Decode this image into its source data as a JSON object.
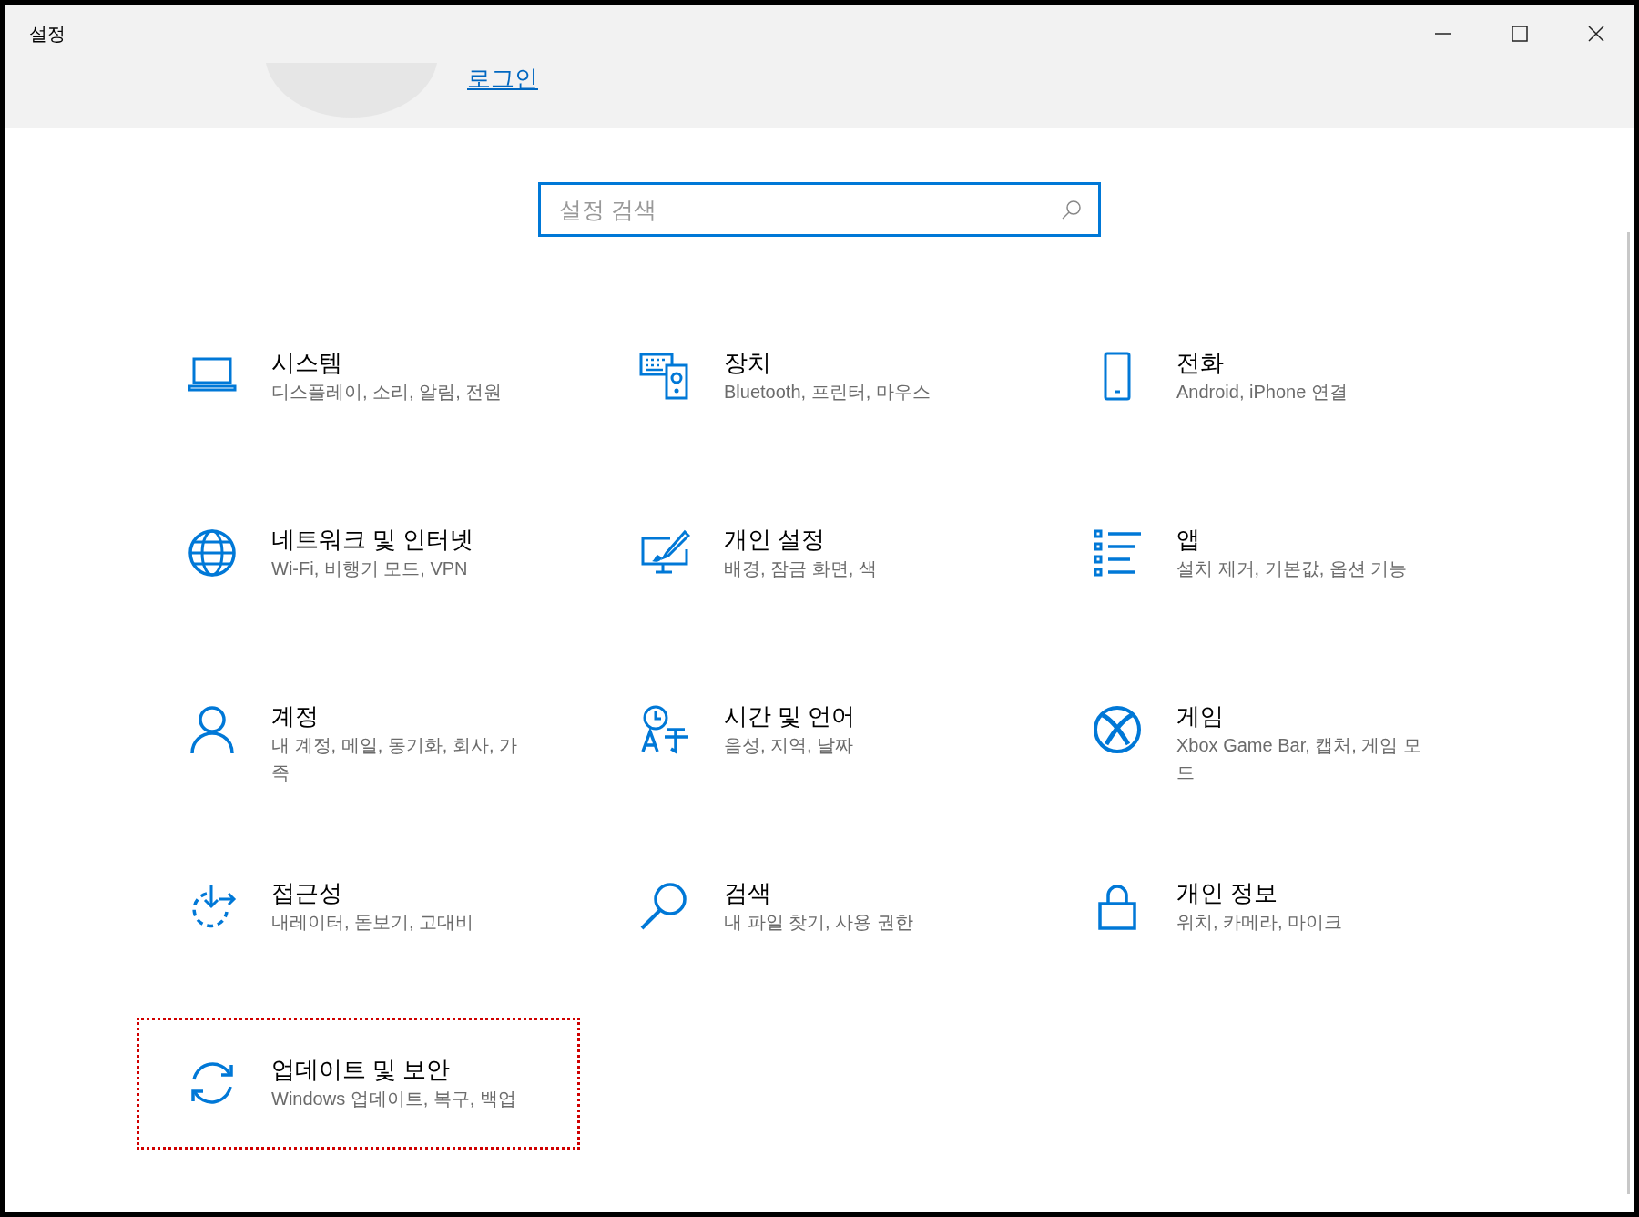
{
  "window": {
    "title": "설정"
  },
  "account": {
    "link": "로그인"
  },
  "search": {
    "placeholder": "설정 검색"
  },
  "tiles": [
    {
      "title": "시스템",
      "description": "디스플레이, 소리, 알림, 전원",
      "highlighted": false
    },
    {
      "title": "장치",
      "description": "Bluetooth, 프린터, 마우스",
      "highlighted": false
    },
    {
      "title": "전화",
      "description": "Android, iPhone 연결",
      "highlighted": false
    },
    {
      "title": "네트워크 및 인터넷",
      "description": "Wi-Fi, 비행기 모드, VPN",
      "highlighted": false
    },
    {
      "title": "개인 설정",
      "description": "배경, 잠금 화면, 색",
      "highlighted": false
    },
    {
      "title": "앱",
      "description": "설치 제거, 기본값, 옵션 기능",
      "highlighted": false
    },
    {
      "title": "계정",
      "description": "내 계정, 메일, 동기화, 회사, 가족",
      "highlighted": false
    },
    {
      "title": "시간 및 언어",
      "description": "음성, 지역, 날짜",
      "highlighted": false
    },
    {
      "title": "게임",
      "description": "Xbox Game Bar, 캡처, 게임 모드",
      "highlighted": false
    },
    {
      "title": "접근성",
      "description": "내레이터, 돋보기, 고대비",
      "highlighted": false
    },
    {
      "title": "검색",
      "description": "내 파일 찾기, 사용 권한",
      "highlighted": false
    },
    {
      "title": "개인 정보",
      "description": "위치, 카메라, 마이크",
      "highlighted": false
    },
    {
      "title": "업데이트 및 보안",
      "description": "Windows 업데이트, 복구, 백업",
      "highlighted": true
    }
  ]
}
